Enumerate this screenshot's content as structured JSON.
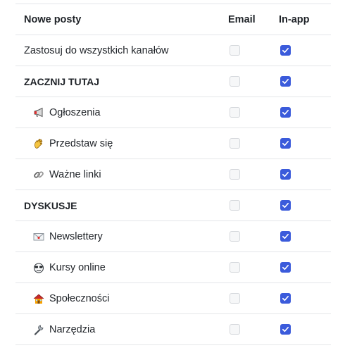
{
  "header": {
    "title": "Nowe posty",
    "email_label": "Email",
    "inapp_label": "In-app"
  },
  "rows": [
    {
      "label": "Zastosuj do wszystkich kanałów",
      "email": false,
      "inapp": true
    },
    {
      "label": "ZACZNIJ TUTAJ",
      "email": false,
      "inapp": true
    },
    {
      "label": "Ogłoszenia",
      "icon": "megaphone-icon",
      "email": false,
      "inapp": true
    },
    {
      "label": "Przedstaw się",
      "icon": "waving-hand-icon",
      "email": false,
      "inapp": true
    },
    {
      "label": "Ważne linki",
      "icon": "link-icon",
      "email": false,
      "inapp": true
    },
    {
      "label": "DYSKUSJE",
      "email": false,
      "inapp": true
    },
    {
      "label": "Newslettery",
      "icon": "envelope-icon",
      "email": false,
      "inapp": true
    },
    {
      "label": "Kursy online",
      "icon": "sunglasses-face-icon",
      "email": false,
      "inapp": true
    },
    {
      "label": "Społeczności",
      "icon": "house-icon",
      "email": false,
      "inapp": true
    },
    {
      "label": "Narzędzia",
      "icon": "wrench-icon",
      "email": false,
      "inapp": true
    }
  ],
  "colors": {
    "checked": "#3b5bdb",
    "unchecked_border": "#d5d8dc",
    "divider": "#e4e6e9"
  }
}
